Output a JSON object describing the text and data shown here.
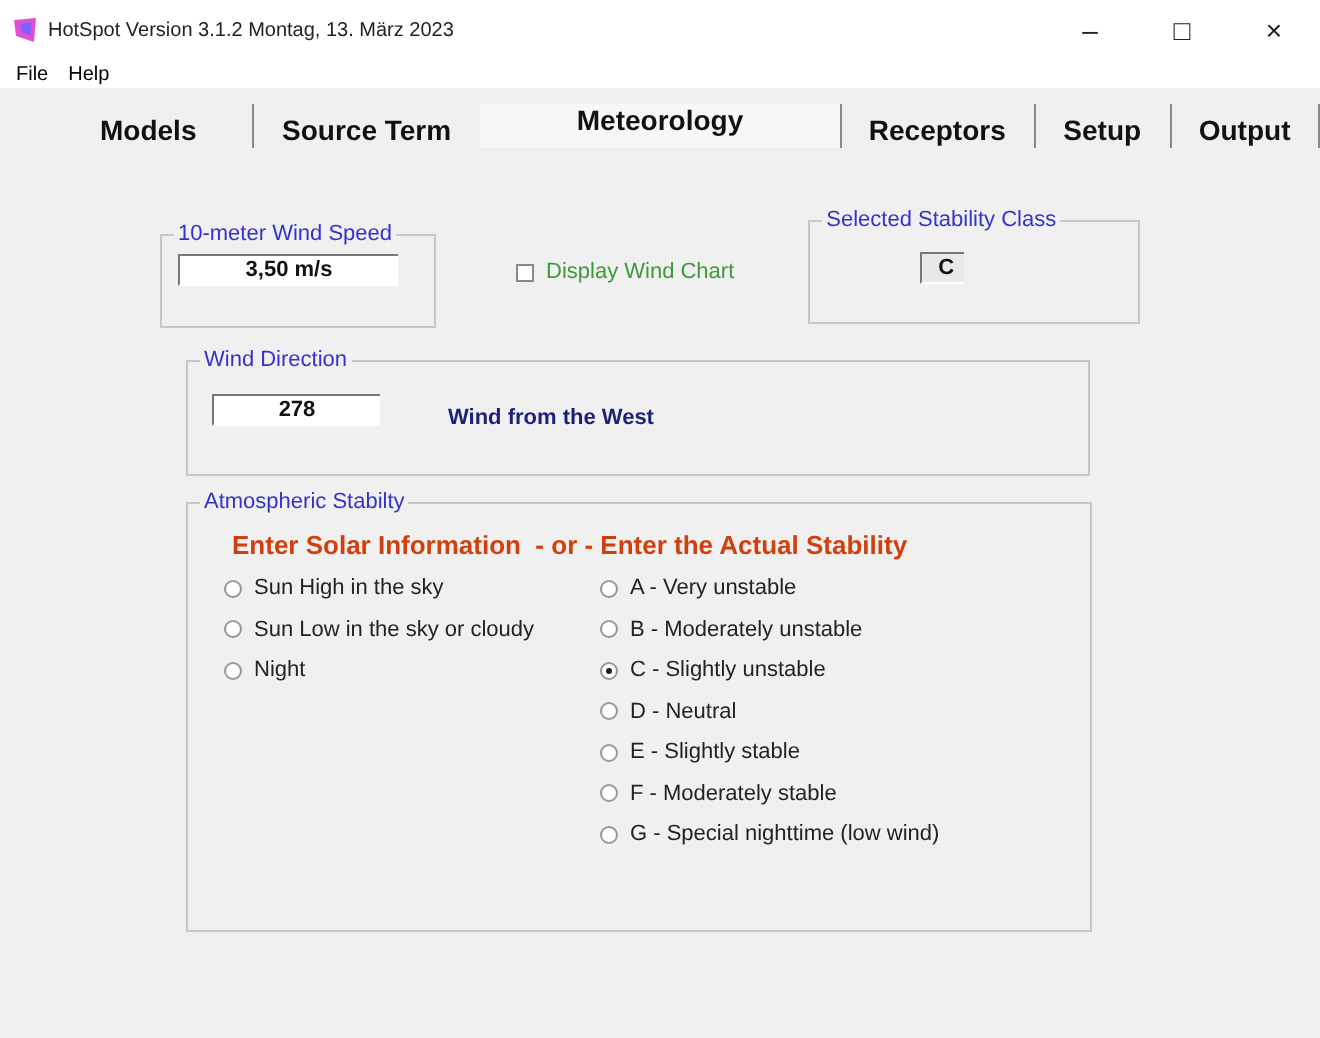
{
  "window": {
    "title": "HotSpot Version 3.1.2 Montag, 13. März 2023",
    "controls": [
      "–",
      "□",
      "×"
    ]
  },
  "menu": [
    "File",
    "Help"
  ],
  "tabs": [
    {
      "label": "Models",
      "selected": false
    },
    {
      "label": "Source Term",
      "selected": false
    },
    {
      "label": "Meteorology",
      "selected": true
    },
    {
      "label": "Receptors",
      "selected": false
    },
    {
      "label": "Setup",
      "selected": false
    },
    {
      "label": "Output",
      "selected": false
    }
  ],
  "wind_speed": {
    "label": "10-meter Wind Speed",
    "value": "3,50 m/s"
  },
  "wind_chart": {
    "label": "Display Wind Chart",
    "checked": false
  },
  "stability_class": {
    "label": "Selected Stability Class",
    "value": "C"
  },
  "wind_direction": {
    "label": "Wind Direction",
    "value": "278",
    "description": "Wind from the West"
  },
  "atmospheric_stability": {
    "label": "Atmospheric Stabilty",
    "heading": "Enter Solar Information  - or - Enter the Actual Stability",
    "solar_options": [
      {
        "label": "Sun High in the sky",
        "selected": false
      },
      {
        "label": "Sun Low in the sky or cloudy",
        "selected": false
      },
      {
        "label": "Night",
        "selected": false
      }
    ],
    "stability_options": [
      {
        "label": "A - Very unstable",
        "selected": false
      },
      {
        "label": "B - Moderately unstable",
        "selected": false
      },
      {
        "label": "C - Slightly unstable",
        "selected": true
      },
      {
        "label": "D - Neutral",
        "selected": false
      },
      {
        "label": "E - Slightly stable",
        "selected": false
      },
      {
        "label": "F - Moderately stable",
        "selected": false
      },
      {
        "label": "G - Special nighttime (low wind)",
        "selected": false
      }
    ]
  }
}
